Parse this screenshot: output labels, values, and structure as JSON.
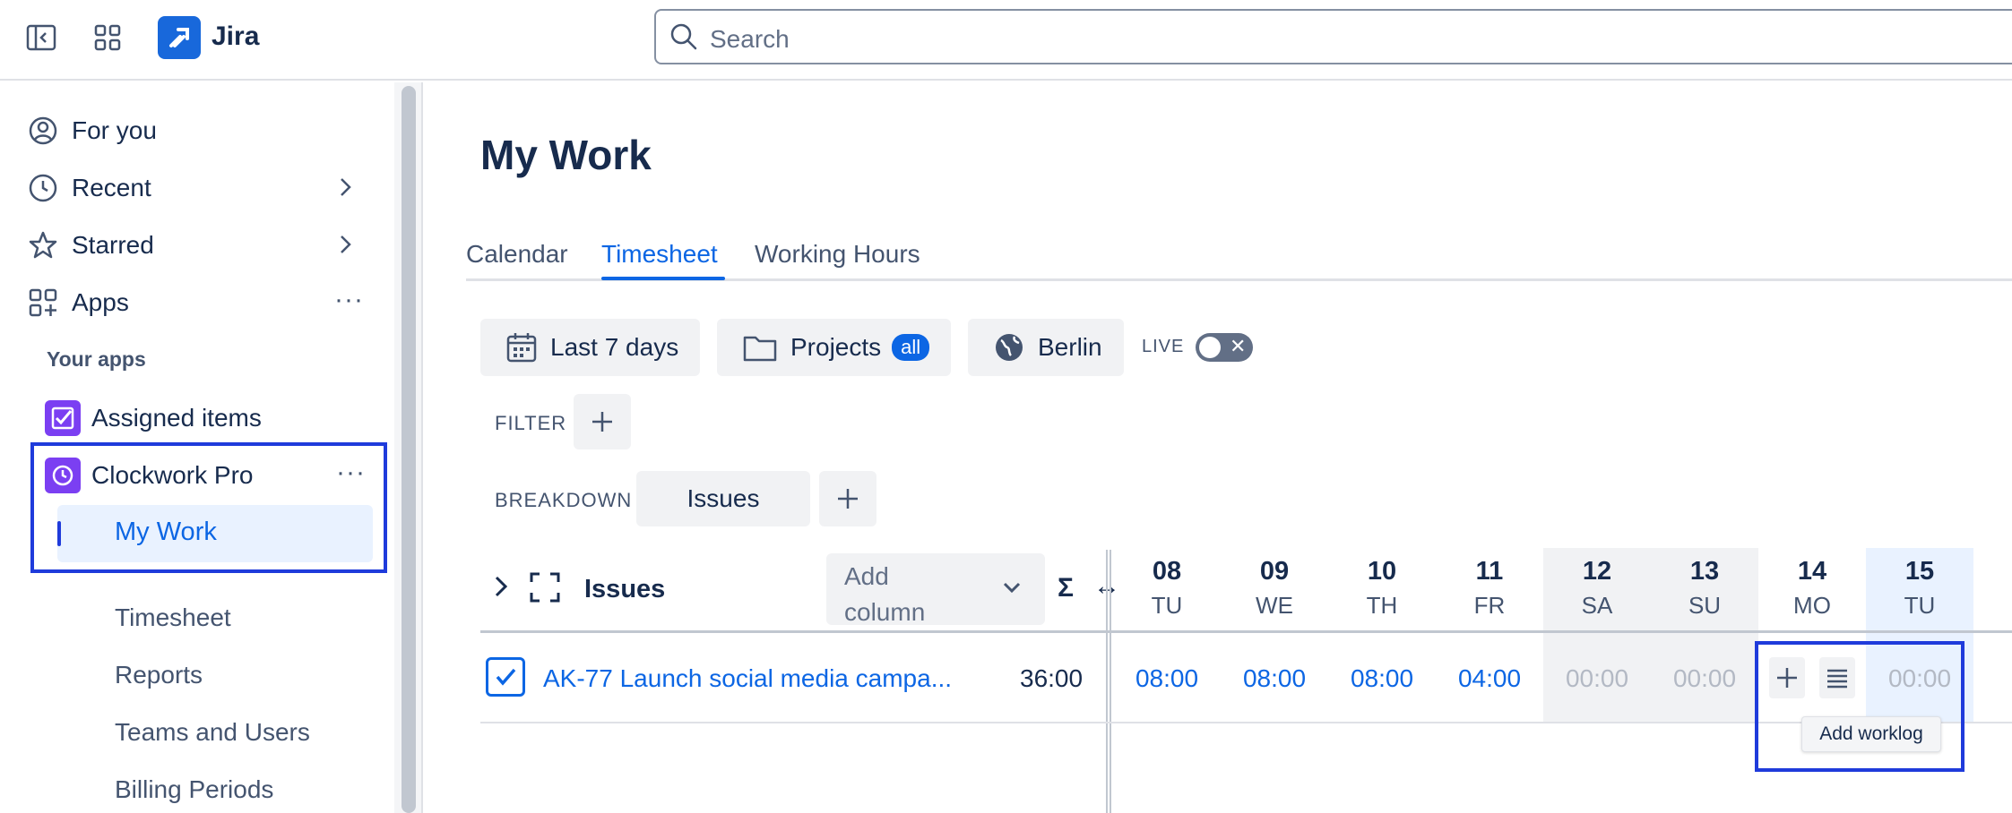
{
  "topbar": {
    "brand": "Jira",
    "search_placeholder": "Search",
    "icons": [
      "sidebar-toggle-icon",
      "app-switcher-icon",
      "jira-logo-icon",
      "search-icon"
    ]
  },
  "sidebar": {
    "items": [
      {
        "label": "For you",
        "icon": "person-circle-icon"
      },
      {
        "label": "Recent",
        "icon": "clock-icon"
      },
      {
        "label": "Starred",
        "icon": "star-icon"
      },
      {
        "label": "Apps",
        "icon": "apps-grid-icon"
      }
    ],
    "section_label": "Your apps",
    "apps": [
      {
        "label": "Assigned items",
        "icon": "assigned-items-app-icon"
      },
      {
        "label": "Clockwork Pro",
        "icon": "clockwork-pro-app-icon"
      }
    ],
    "active_item": "My Work",
    "sub_items": [
      "Timesheet",
      "Reports",
      "Teams and Users",
      "Billing Periods"
    ]
  },
  "main": {
    "title": "My Work",
    "tabs": [
      {
        "label": "Calendar",
        "active": false
      },
      {
        "label": "Timesheet",
        "active": true
      },
      {
        "label": "Working Hours",
        "active": false
      }
    ],
    "controls": {
      "date_range": "Last 7 days",
      "projects_label": "Projects",
      "projects_badge": "all",
      "timezone": "Berlin",
      "live_label": "LIVE",
      "live_toggle_symbol": "✕",
      "filter_label": "FILTER",
      "breakdown_label": "BREAKDOWN",
      "breakdown_chip": "Issues"
    },
    "grid": {
      "issues_header": "Issues",
      "add_column_line1": "Add",
      "add_column_line2": "column",
      "sum_symbol": "Σ",
      "resize_symbol": "↔",
      "days": [
        {
          "num": "08",
          "dow": "TU"
        },
        {
          "num": "09",
          "dow": "WE"
        },
        {
          "num": "10",
          "dow": "TH"
        },
        {
          "num": "11",
          "dow": "FR"
        },
        {
          "num": "12",
          "dow": "SA"
        },
        {
          "num": "13",
          "dow": "SU"
        },
        {
          "num": "14",
          "dow": "MO"
        },
        {
          "num": "15",
          "dow": "TU"
        }
      ],
      "row": {
        "issue": "AK-77 Launch social media campa...",
        "total": "36:00",
        "hours": [
          "08:00",
          "08:00",
          "08:00",
          "04:00",
          "00:00",
          "00:00",
          "",
          "00:00"
        ]
      },
      "tooltip": "Add worklog"
    }
  },
  "colors": {
    "accent": "#0c66e4",
    "highlight_box": "#1f3bdb",
    "app_purple": "#7b3ff2"
  }
}
